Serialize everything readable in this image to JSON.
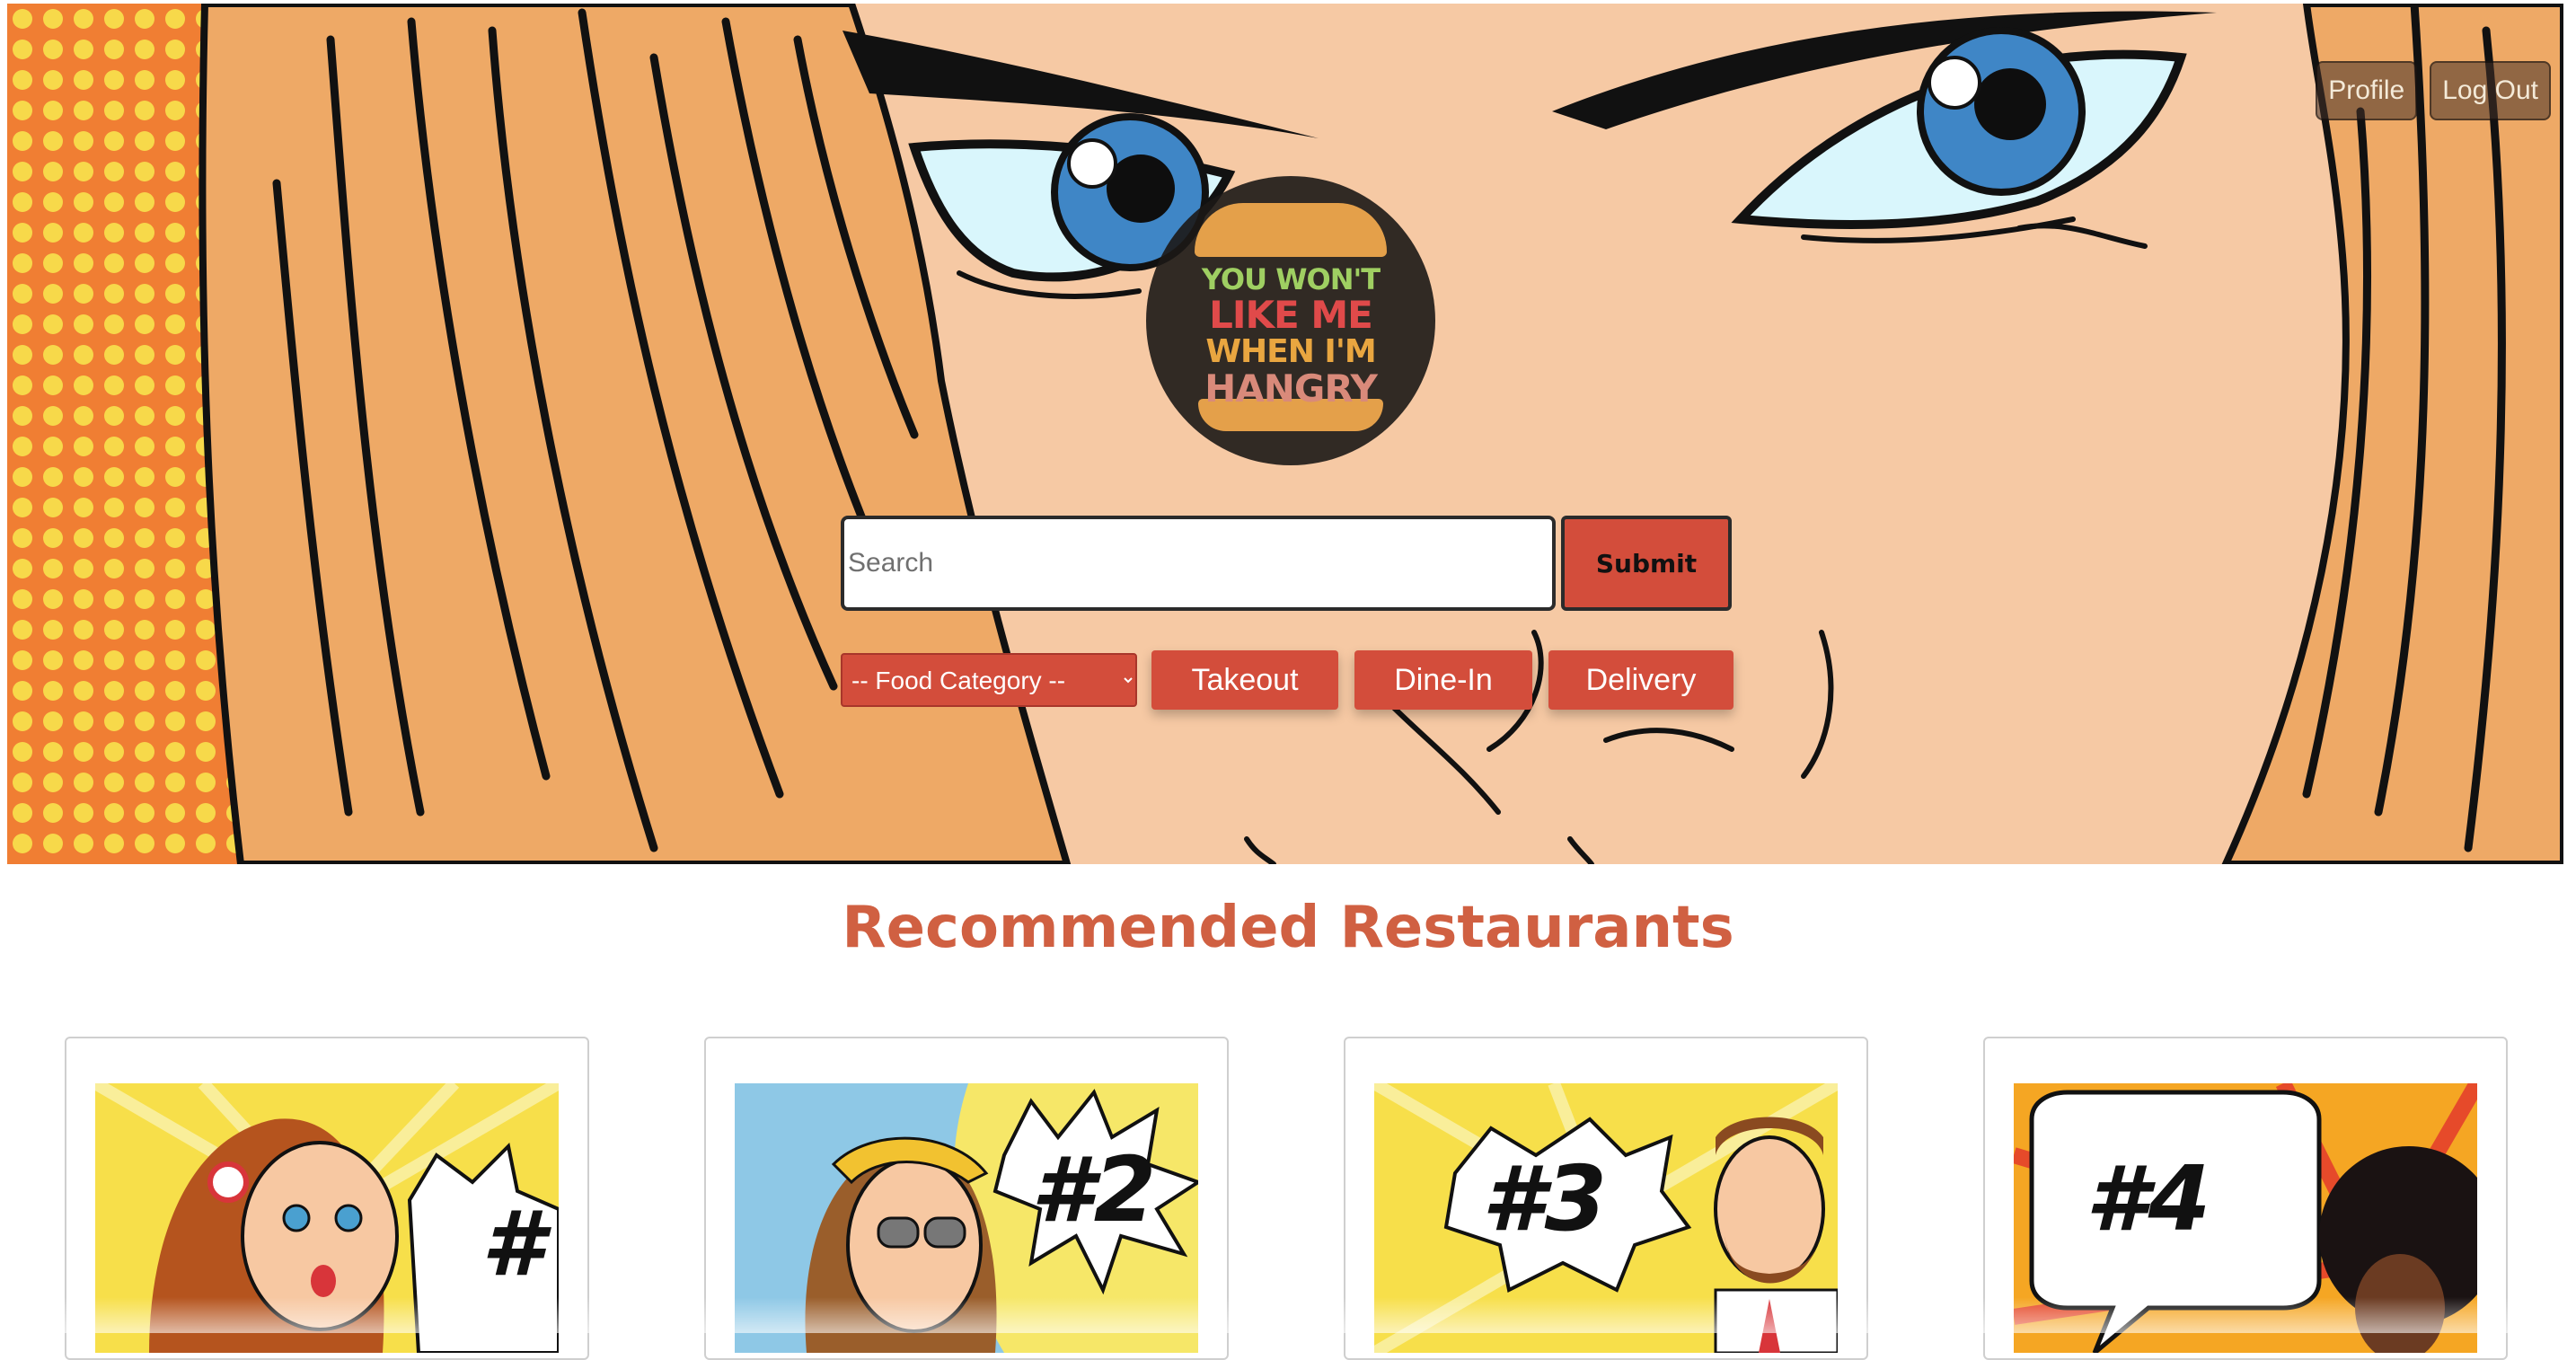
{
  "header": {
    "profile_label": "Profile",
    "logout_label": "Log Out"
  },
  "logo": {
    "line1": "YOU WON'T",
    "line2": "LIKE ME",
    "line3": "WHEN I'M",
    "line4": "HANGRY"
  },
  "search": {
    "placeholder": "Search",
    "submit_label": "Submit"
  },
  "filters": {
    "category_selected": "-- Food Category --",
    "takeout_label": "Takeout",
    "dinein_label": "Dine-In",
    "delivery_label": "Delivery"
  },
  "recommended": {
    "title": "Recommended Restaurants",
    "cards": [
      {
        "rank": "#"
      },
      {
        "rank": "#2"
      },
      {
        "rank": "#3"
      },
      {
        "rank": "#4"
      }
    ]
  },
  "colors": {
    "accent": "#d34d3b",
    "title": "#d06042",
    "skin": "#f6c9a4",
    "hair": "#eea966"
  }
}
